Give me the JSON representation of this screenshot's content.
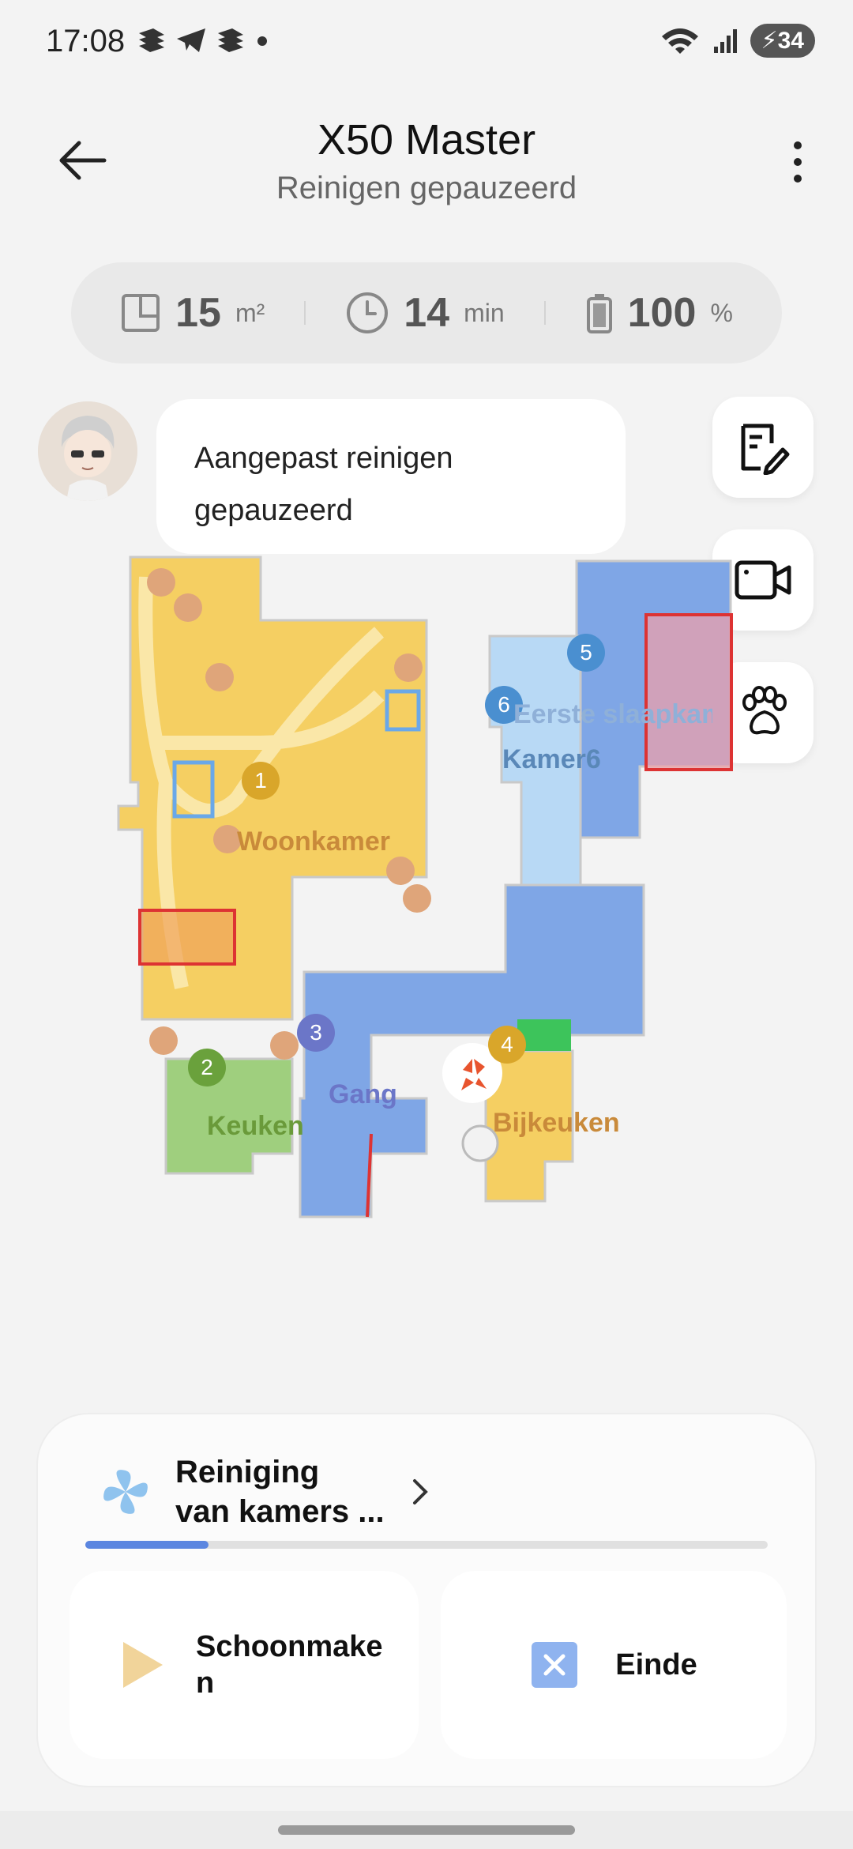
{
  "status_bar": {
    "time": "17:08",
    "battery": "34"
  },
  "header": {
    "title": "X50 Master",
    "subtitle": "Reinigen gepauzeerd"
  },
  "stats": {
    "area_value": "15",
    "area_unit": "m²",
    "time_value": "14",
    "time_unit": "min",
    "battery_value": "100",
    "battery_unit": "%"
  },
  "message": "Aangepast reinigen gepauzeerd",
  "side_buttons": [
    "edit-map-icon",
    "camera-icon",
    "pet-paw-icon"
  ],
  "map": {
    "rooms": [
      {
        "num": "1",
        "name": "Woonkamer",
        "color": "#d9a62a"
      },
      {
        "num": "2",
        "name": "Keuken",
        "color": "#6aa13c"
      },
      {
        "num": "3",
        "name": "Gang",
        "color": "#6b76c8"
      },
      {
        "num": "4",
        "name": "Bijkeuken",
        "color": "#d9a62a"
      },
      {
        "num": "5",
        "name": "Eerste slaapkamer",
        "color": "#4a8fd0"
      },
      {
        "num": "6",
        "name": "Kamer6",
        "color": "#4a8fd0"
      }
    ]
  },
  "bottom": {
    "mode_line1": "Reiniging",
    "mode_line2": "van kamers ...",
    "progress": 0.18,
    "start_line1": "Schoonmake",
    "start_line2": "n",
    "end_label": "Einde"
  }
}
